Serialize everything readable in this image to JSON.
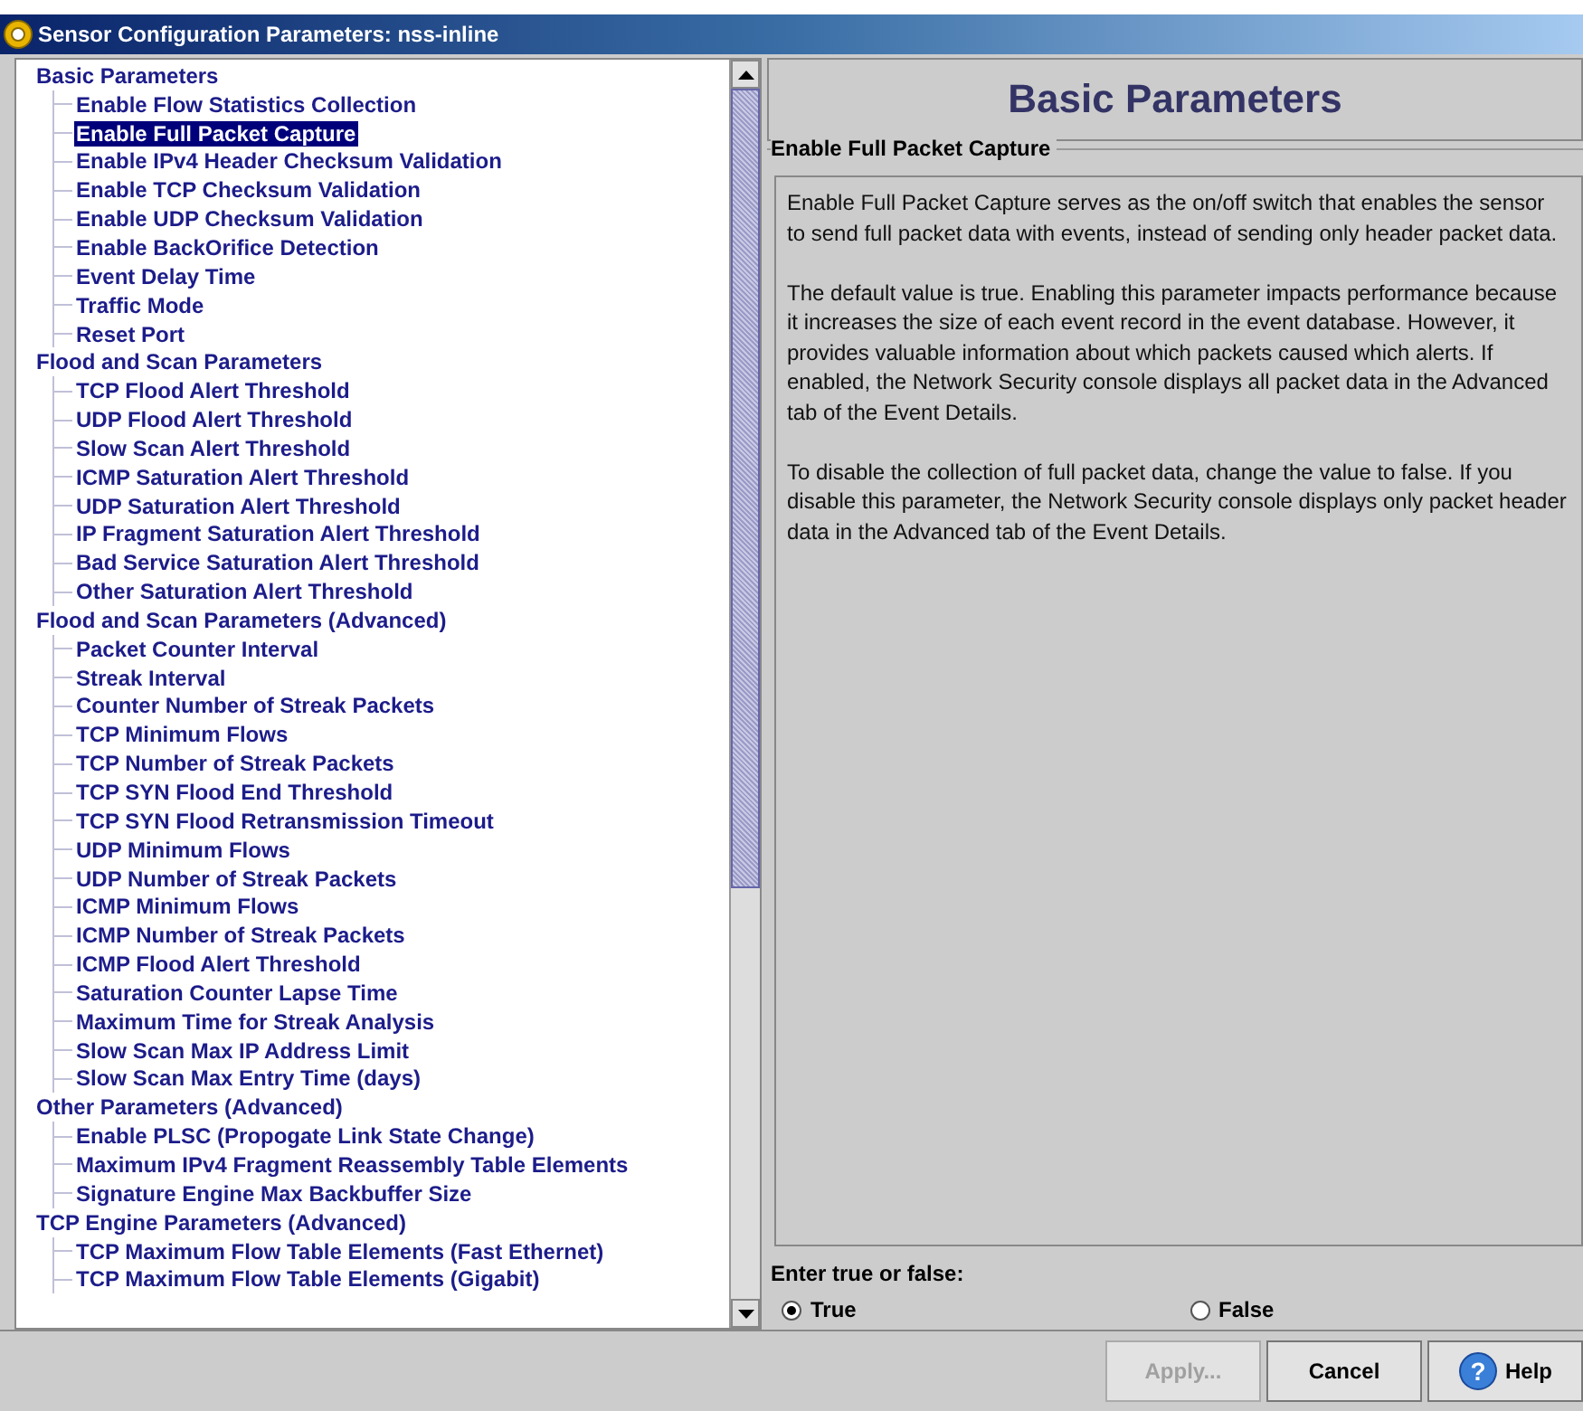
{
  "window": {
    "title": "Sensor Configuration Parameters: nss-inline"
  },
  "tree": [
    {
      "label": "Basic Parameters",
      "selected": false,
      "children": [
        {
          "label": "Enable Flow Statistics Collection",
          "selected": false
        },
        {
          "label": "Enable Full Packet Capture",
          "selected": true
        },
        {
          "label": "Enable IPv4 Header Checksum Validation",
          "selected": false
        },
        {
          "label": "Enable TCP Checksum Validation",
          "selected": false
        },
        {
          "label": "Enable UDP Checksum Validation",
          "selected": false
        },
        {
          "label": "Enable BackOrifice Detection",
          "selected": false
        },
        {
          "label": "Event Delay Time",
          "selected": false
        },
        {
          "label": "Traffic Mode",
          "selected": false
        },
        {
          "label": "Reset Port",
          "selected": false
        }
      ]
    },
    {
      "label": "Flood and Scan Parameters",
      "selected": false,
      "children": [
        {
          "label": "TCP Flood Alert Threshold",
          "selected": false
        },
        {
          "label": "UDP Flood Alert Threshold",
          "selected": false
        },
        {
          "label": "Slow Scan Alert Threshold",
          "selected": false
        },
        {
          "label": "ICMP Saturation Alert Threshold",
          "selected": false
        },
        {
          "label": "UDP Saturation Alert Threshold",
          "selected": false
        },
        {
          "label": "IP Fragment Saturation Alert Threshold",
          "selected": false
        },
        {
          "label": "Bad Service Saturation Alert Threshold",
          "selected": false
        },
        {
          "label": "Other Saturation Alert Threshold",
          "selected": false
        }
      ]
    },
    {
      "label": "Flood and Scan Parameters (Advanced)",
      "selected": false,
      "children": [
        {
          "label": "Packet Counter Interval",
          "selected": false
        },
        {
          "label": "Streak Interval",
          "selected": false
        },
        {
          "label": "Counter Number of Streak Packets",
          "selected": false
        },
        {
          "label": "TCP Minimum Flows",
          "selected": false
        },
        {
          "label": "TCP Number of Streak Packets",
          "selected": false
        },
        {
          "label": "TCP SYN Flood End Threshold",
          "selected": false
        },
        {
          "label": "TCP SYN Flood Retransmission Timeout",
          "selected": false
        },
        {
          "label": "UDP Minimum Flows",
          "selected": false
        },
        {
          "label": "UDP Number of Streak Packets",
          "selected": false
        },
        {
          "label": "ICMP Minimum Flows",
          "selected": false
        },
        {
          "label": "ICMP Number of Streak Packets",
          "selected": false
        },
        {
          "label": "ICMP Flood Alert Threshold",
          "selected": false
        },
        {
          "label": "Saturation Counter Lapse Time",
          "selected": false
        },
        {
          "label": "Maximum Time for Streak Analysis",
          "selected": false
        },
        {
          "label": "Slow Scan Max IP Address Limit",
          "selected": false
        },
        {
          "label": "Slow Scan Max Entry Time (days)",
          "selected": false
        }
      ]
    },
    {
      "label": "Other Parameters (Advanced)",
      "selected": false,
      "children": [
        {
          "label": "Enable PLSC (Propogate Link State Change)",
          "selected": false
        },
        {
          "label": "Maximum IPv4 Fragment Reassembly Table Elements",
          "selected": false
        },
        {
          "label": "Signature Engine Max Backbuffer Size",
          "selected": false
        }
      ]
    },
    {
      "label": "TCP Engine Parameters (Advanced)",
      "selected": false,
      "children": [
        {
          "label": "TCP Maximum Flow Table Elements (Fast Ethernet)",
          "selected": false
        },
        {
          "label": "TCP Maximum Flow Table Elements (Gigabit)",
          "selected": false
        }
      ]
    }
  ],
  "panel": {
    "heading": "Basic Parameters",
    "group_title": "Enable Full Packet Capture",
    "paragraphs": [
      "Enable Full Packet Capture serves as the on/off switch that enables the sensor to send full packet data with events, instead of sending only header packet data.",
      "The default value is true. Enabling this parameter impacts performance because it increases the size of each event record in the event database. However, it provides valuable information about which packets caused which alerts. If enabled, the Network Security console displays all packet data in the Advanced tab of the Event Details.",
      "To disable the collection of full packet data, change the value to false. If you disable this parameter, the Network Security console displays only packet header data in the Advanced tab of the Event Details."
    ],
    "prompt": "Enter true or false:",
    "options": [
      {
        "label": "True",
        "selected": true
      },
      {
        "label": "False",
        "selected": false
      }
    ]
  },
  "buttons": [
    {
      "label": "Apply...",
      "disabled": true,
      "kind": "plain"
    },
    {
      "label": "Cancel",
      "disabled": false,
      "kind": "plain"
    },
    {
      "label": "Help",
      "disabled": false,
      "kind": "help",
      "icon": "?"
    }
  ]
}
